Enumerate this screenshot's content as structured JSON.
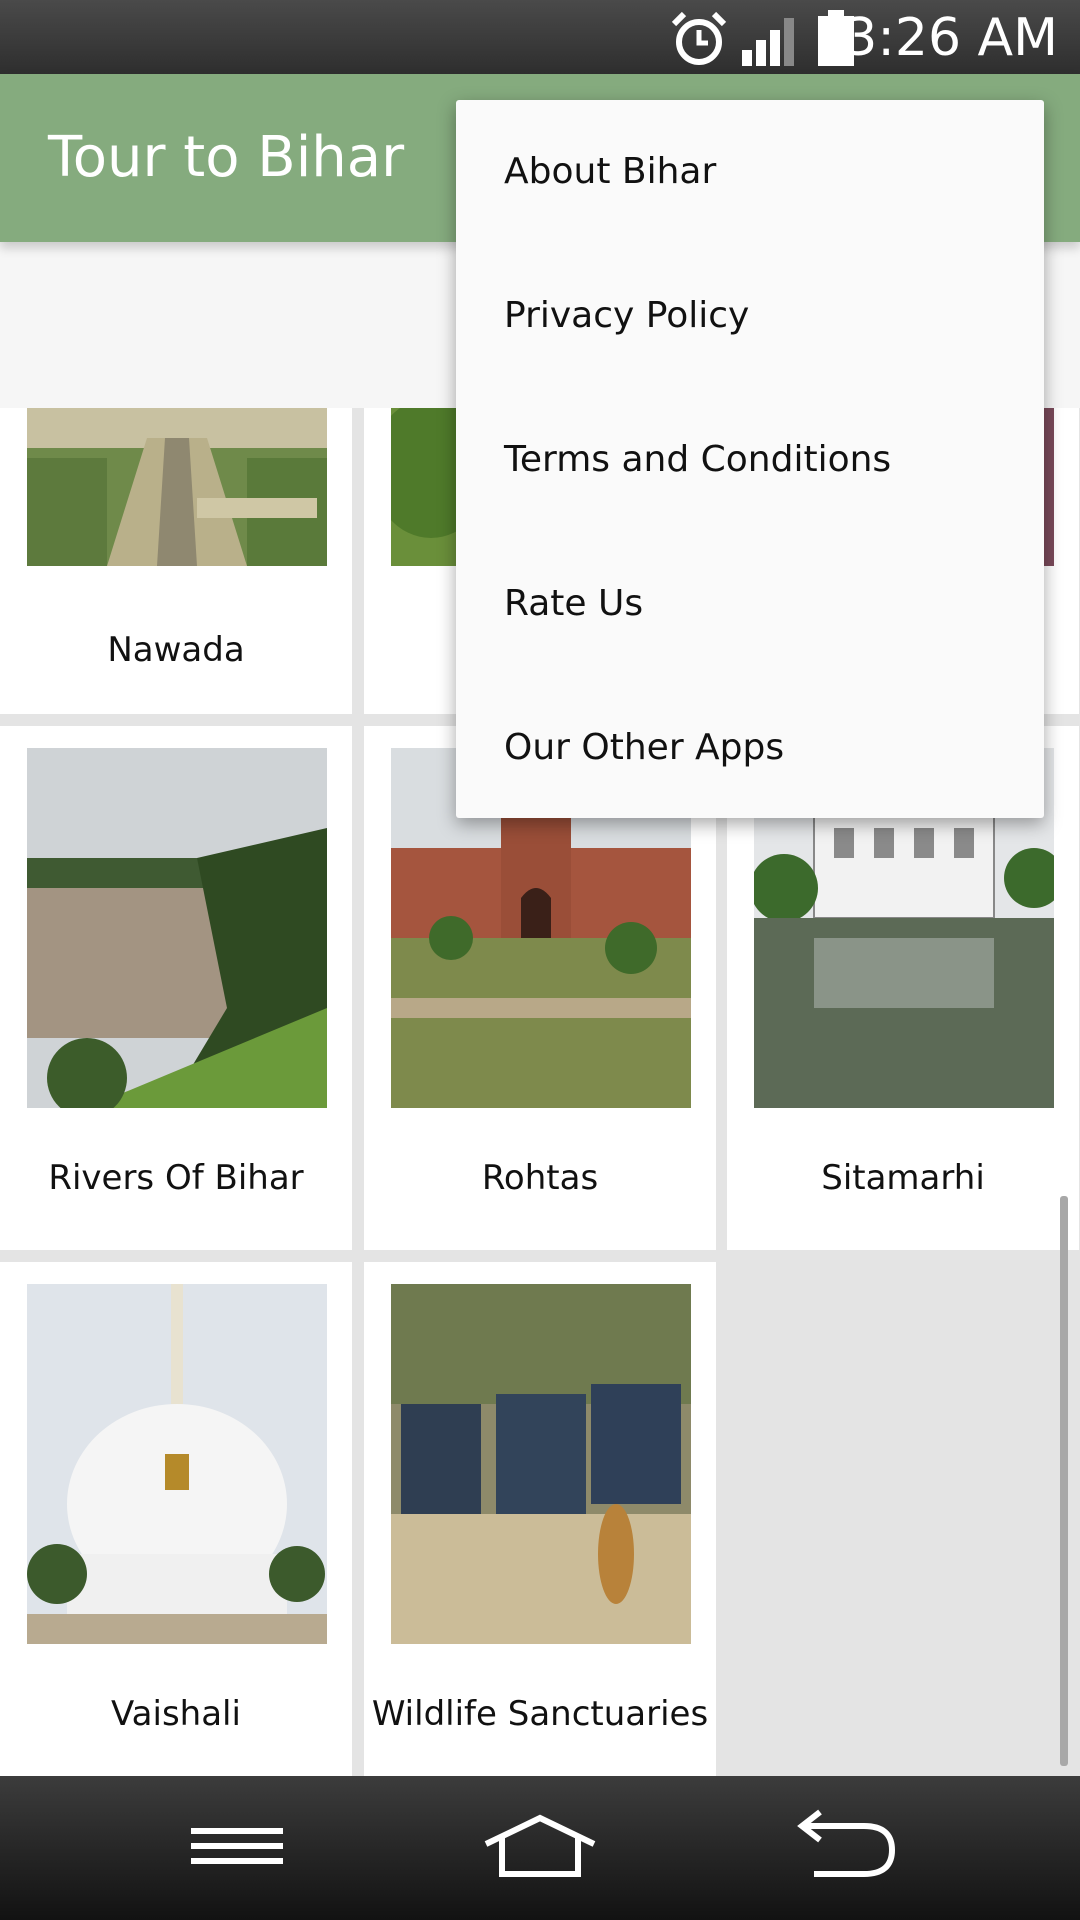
{
  "status_bar": {
    "time": "3:26 AM",
    "icons": [
      "alarm-icon",
      "signal-icon",
      "battery-icon"
    ]
  },
  "app_bar": {
    "title": "Tour to Bihar",
    "color": "#85ab7e"
  },
  "grid": {
    "tiles": [
      {
        "label": "Nawada",
        "image": "stepwell-photo"
      },
      {
        "label": "",
        "image": "green-field-photo"
      },
      {
        "label": "",
        "image": "partial-photo"
      },
      {
        "label": "Rivers Of Bihar",
        "image": "river-photo"
      },
      {
        "label": "Rohtas",
        "image": "fort-photo"
      },
      {
        "label": "Sitamarhi",
        "image": "temple-pond-photo"
      },
      {
        "label": "Vaishali",
        "image": "stupa-photo"
      },
      {
        "label": "Wildlife Sanctuaries",
        "image": "safari-photo"
      }
    ]
  },
  "menu": {
    "items": [
      {
        "label": "About Bihar"
      },
      {
        "label": "Privacy Policy"
      },
      {
        "label": "Terms and Conditions"
      },
      {
        "label": "Rate Us"
      },
      {
        "label": "Our Other Apps"
      }
    ]
  },
  "nav_bar": {
    "icons": [
      "menu-icon",
      "home-icon",
      "back-icon"
    ]
  }
}
